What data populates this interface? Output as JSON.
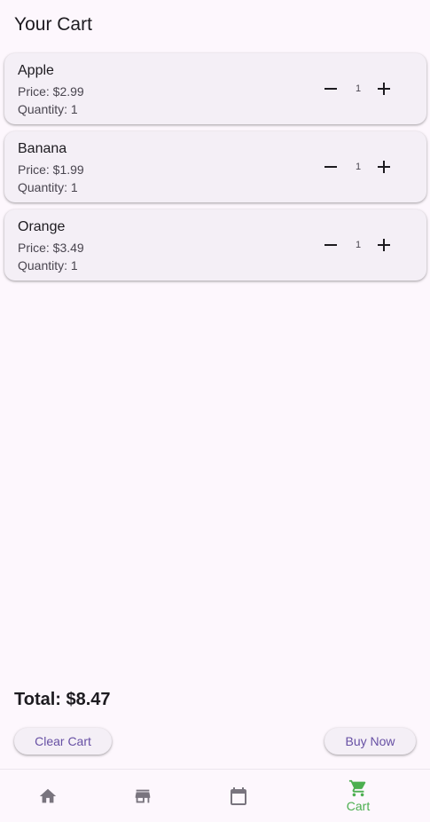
{
  "header": {
    "title": "Your Cart"
  },
  "cart": {
    "items": [
      {
        "name": "Apple",
        "price": "Price: $2.99",
        "quantity": "Quantity: 1",
        "stepper_value": "1"
      },
      {
        "name": "Banana",
        "price": "Price: $1.99",
        "quantity": "Quantity: 1",
        "stepper_value": "1"
      },
      {
        "name": "Orange",
        "price": "Price: $3.49",
        "quantity": "Quantity: 1",
        "stepper_value": "1"
      }
    ],
    "total": "Total: $8.47"
  },
  "actions": {
    "clear_label": "Clear Cart",
    "buy_label": "Buy Now"
  },
  "nav": {
    "items": [
      {
        "icon": "home-icon",
        "label": "",
        "active": false
      },
      {
        "icon": "store-icon",
        "label": "",
        "active": false
      },
      {
        "icon": "calendar-icon",
        "label": "",
        "active": false
      },
      {
        "icon": "cart-icon",
        "label": "Cart",
        "active": true
      }
    ]
  },
  "colors": {
    "background": "#fdf7fd",
    "card": "#f4eff6",
    "accent": "#6750a4",
    "active_nav": "#4caf50",
    "inactive_nav": "#79747e"
  }
}
